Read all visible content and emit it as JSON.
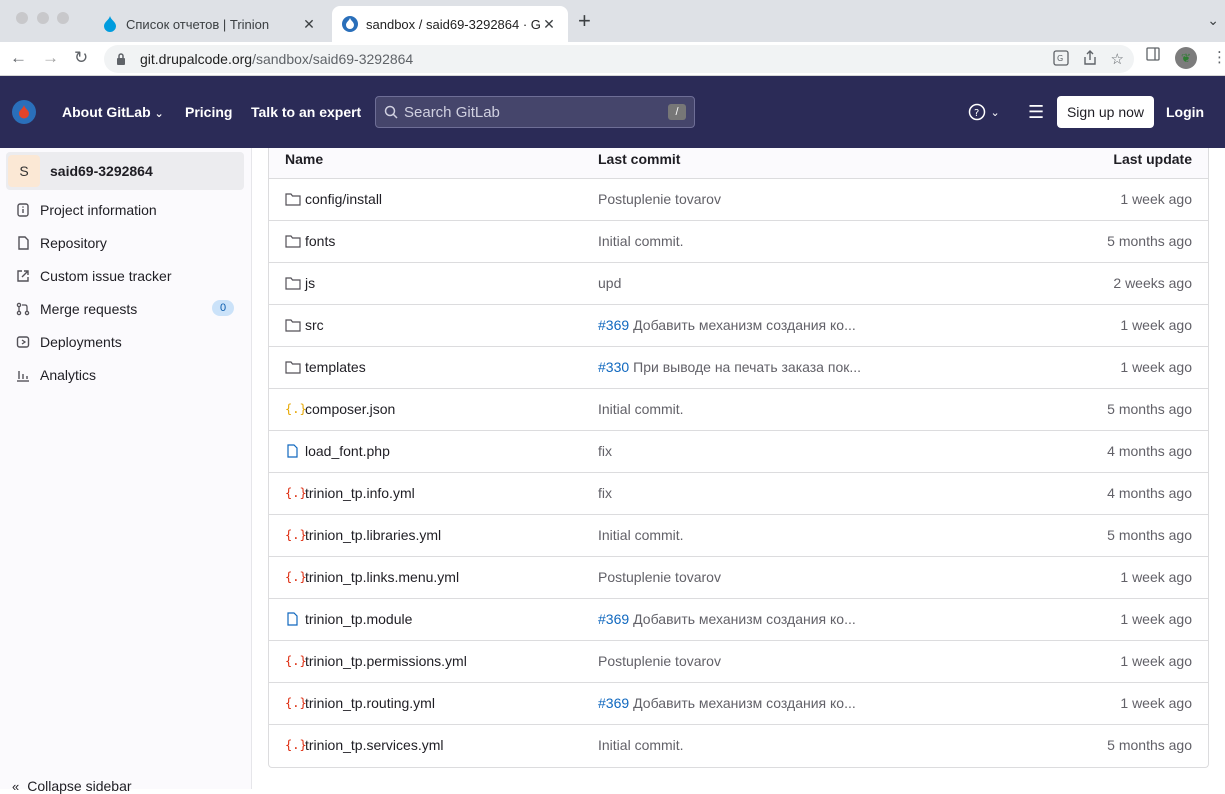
{
  "browser": {
    "tabs": [
      {
        "title": "Список отчетов | Trinion",
        "active": false
      },
      {
        "title": "sandbox / said69-3292864 · G",
        "active": true
      }
    ],
    "url_host": "git.drupalcode.org",
    "url_path": "/sandbox/said69-3292864"
  },
  "header": {
    "about": "About GitLab",
    "pricing": "Pricing",
    "talk": "Talk to an expert",
    "search_placeholder": "Search GitLab",
    "search_shortcut": "/",
    "signup": "Sign up now",
    "login": "Login"
  },
  "sidebar": {
    "project_initial": "S",
    "project_name": "said69-3292864",
    "items": [
      {
        "label": "Project information",
        "icon": "info-icon"
      },
      {
        "label": "Repository",
        "icon": "doc-icon"
      },
      {
        "label": "Custom issue tracker",
        "icon": "external-link-icon"
      },
      {
        "label": "Merge requests",
        "icon": "merge-request-icon",
        "badge": "0"
      },
      {
        "label": "Deployments",
        "icon": "deployments-icon"
      },
      {
        "label": "Analytics",
        "icon": "chart-icon"
      }
    ],
    "collapse": "Collapse sidebar"
  },
  "table": {
    "headers": {
      "name": "Name",
      "commit": "Last commit",
      "update": "Last update"
    },
    "rows": [
      {
        "name": "config/install",
        "type": "folder",
        "ref": "",
        "commit": "Postuplenie tovarov",
        "date": "1 week ago"
      },
      {
        "name": "fonts",
        "type": "folder",
        "ref": "",
        "commit": "Initial commit.",
        "date": "5 months ago"
      },
      {
        "name": "js",
        "type": "folder",
        "ref": "",
        "commit": "upd",
        "date": "2 weeks ago"
      },
      {
        "name": "src",
        "type": "folder",
        "ref": "#369",
        "commit": "Добавить механизм создания ко...",
        "date": "1 week ago"
      },
      {
        "name": "templates",
        "type": "folder",
        "ref": "#330",
        "commit": "При выводе на печать заказа пок...",
        "date": "1 week ago"
      },
      {
        "name": "composer.json",
        "type": "json",
        "ref": "",
        "commit": "Initial commit.",
        "date": "5 months ago"
      },
      {
        "name": "load_font.php",
        "type": "file",
        "ref": "",
        "commit": "fix",
        "date": "4 months ago"
      },
      {
        "name": "trinion_tp.info.yml",
        "type": "yaml",
        "ref": "",
        "commit": "fix",
        "date": "4 months ago"
      },
      {
        "name": "trinion_tp.libraries.yml",
        "type": "yaml",
        "ref": "",
        "commit": "Initial commit.",
        "date": "5 months ago"
      },
      {
        "name": "trinion_tp.links.menu.yml",
        "type": "yaml",
        "ref": "",
        "commit": "Postuplenie tovarov",
        "date": "1 week ago"
      },
      {
        "name": "trinion_tp.module",
        "type": "file",
        "ref": "#369",
        "commit": "Добавить механизм создания ко...",
        "date": "1 week ago"
      },
      {
        "name": "trinion_tp.permissions.yml",
        "type": "yaml",
        "ref": "",
        "commit": "Postuplenie tovarov",
        "date": "1 week ago"
      },
      {
        "name": "trinion_tp.routing.yml",
        "type": "yaml",
        "ref": "#369",
        "commit": "Добавить механизм создания ко...",
        "date": "1 week ago"
      },
      {
        "name": "trinion_tp.services.yml",
        "type": "yaml",
        "ref": "",
        "commit": "Initial commit.",
        "date": "5 months ago"
      }
    ]
  },
  "colors": {
    "header_bg": "#2b2b57",
    "link": "#1068bf",
    "yaml_icon": "#dd2b0e",
    "json_icon": "#e6a700",
    "file_icon": "#1068bf"
  }
}
